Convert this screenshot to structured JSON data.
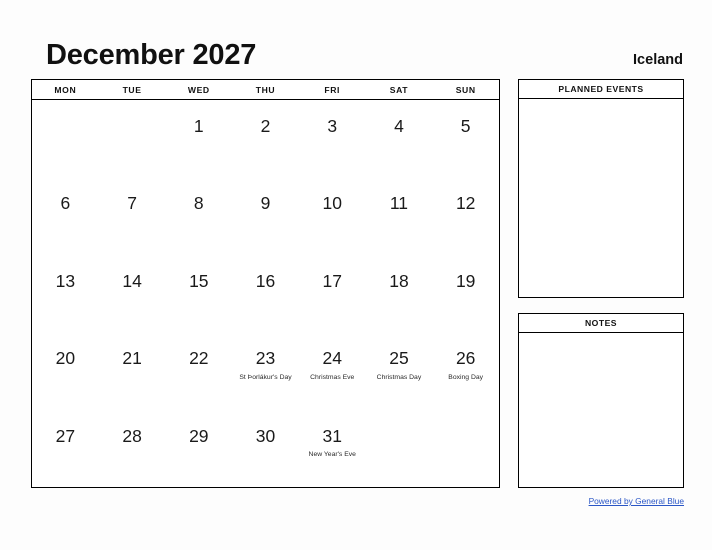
{
  "header": {
    "month_title": "December 2027",
    "country": "Iceland"
  },
  "calendar": {
    "weekdays": [
      "MON",
      "TUE",
      "WED",
      "THU",
      "FRI",
      "SAT",
      "SUN"
    ],
    "weeks": [
      [
        {
          "day": ""
        },
        {
          "day": ""
        },
        {
          "day": "1"
        },
        {
          "day": "2"
        },
        {
          "day": "3"
        },
        {
          "day": "4"
        },
        {
          "day": "5"
        }
      ],
      [
        {
          "day": "6"
        },
        {
          "day": "7"
        },
        {
          "day": "8"
        },
        {
          "day": "9"
        },
        {
          "day": "10"
        },
        {
          "day": "11"
        },
        {
          "day": "12"
        }
      ],
      [
        {
          "day": "13"
        },
        {
          "day": "14"
        },
        {
          "day": "15"
        },
        {
          "day": "16"
        },
        {
          "day": "17"
        },
        {
          "day": "18"
        },
        {
          "day": "19"
        }
      ],
      [
        {
          "day": "20"
        },
        {
          "day": "21"
        },
        {
          "day": "22"
        },
        {
          "day": "23",
          "event": "St Þorlákur's Day"
        },
        {
          "day": "24",
          "event": "Christmas Eve"
        },
        {
          "day": "25",
          "event": "Christmas Day"
        },
        {
          "day": "26",
          "event": "Boxing Day"
        }
      ],
      [
        {
          "day": "27"
        },
        {
          "day": "28"
        },
        {
          "day": "29"
        },
        {
          "day": "30"
        },
        {
          "day": "31",
          "event": "New Year's Eve"
        },
        {
          "day": ""
        },
        {
          "day": ""
        }
      ]
    ]
  },
  "panels": {
    "planned_events": {
      "title": "PLANNED EVENTS",
      "content": ""
    },
    "notes": {
      "title": "NOTES",
      "content": ""
    }
  },
  "footer": {
    "link_text": "Powered by General Blue",
    "link_color": "#2a56c6"
  }
}
